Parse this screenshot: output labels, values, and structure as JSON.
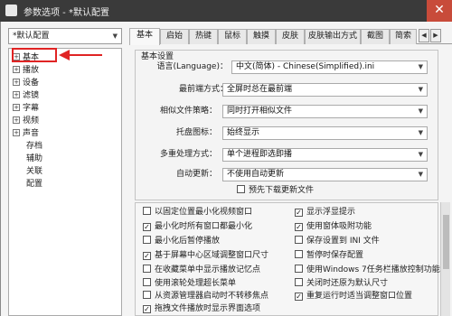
{
  "window": {
    "title": "参数选项 - *默认配置",
    "close_label": "✕"
  },
  "preset": {
    "value": "*默认配置"
  },
  "tree": {
    "items": [
      {
        "label": "基本",
        "expandable": true
      },
      {
        "label": "播放",
        "expandable": true
      },
      {
        "label": "设备",
        "expandable": true
      },
      {
        "label": "滤镜",
        "expandable": true
      },
      {
        "label": "字幕",
        "expandable": true
      },
      {
        "label": "视频",
        "expandable": true
      },
      {
        "label": "声音",
        "expandable": true
      },
      {
        "label": "存档",
        "expandable": false
      },
      {
        "label": "辅助",
        "expandable": false
      },
      {
        "label": "关联",
        "expandable": false
      },
      {
        "label": "配置",
        "expandable": false
      }
    ],
    "highlight_color": "#e02424"
  },
  "tabs": [
    {
      "label": "基本",
      "active": true
    },
    {
      "label": "启始",
      "active": false
    },
    {
      "label": "热键",
      "active": false
    },
    {
      "label": "鼠标",
      "active": false
    },
    {
      "label": "触摸",
      "active": false
    },
    {
      "label": "皮肤",
      "active": false
    },
    {
      "label": "皮肤输出方式",
      "active": false
    },
    {
      "label": "截图",
      "active": false
    },
    {
      "label": "简索",
      "active": false
    }
  ],
  "tab_scroll": {
    "left": "◀",
    "right": "▶"
  },
  "basic": {
    "group_title": "基本设置",
    "rows": [
      {
        "label": "语言(Language)：",
        "value": "中文(简体) - Chinese(Simplified).ini"
      },
      {
        "label": "最前端方式：",
        "value": "全屏时总在最前端"
      },
      {
        "label": "相似文件策略：",
        "value": "同时打开相似文件"
      },
      {
        "label": "托盘图标：",
        "value": "始终显示"
      },
      {
        "label": "多重处理方式：",
        "value": "单个进程即选即播"
      },
      {
        "label": "自动更新：",
        "value": "不使用自动更新"
      }
    ],
    "predownload": {
      "label": "预先下载更新文件",
      "checked": false
    }
  },
  "options": {
    "left": [
      {
        "label": "以固定位置最小化视频窗口",
        "checked": false
      },
      {
        "label": "最小化时所有窗口都最小化",
        "checked": true
      },
      {
        "label": "最小化后暂停播放",
        "checked": false
      },
      {
        "label": "基于屏幕中心区域调整窗口尺寸",
        "checked": true
      },
      {
        "label": "在收藏菜单中显示播放记忆点",
        "checked": false
      },
      {
        "label": "使用滚轮处理超长菜单",
        "checked": false
      },
      {
        "label": "从资源管理器启动时不转移焦点",
        "checked": false
      },
      {
        "label": "拖拽文件播放时显示界面选项",
        "checked": true
      }
    ],
    "right": [
      {
        "label": "显示浮显提示",
        "checked": true
      },
      {
        "label": "使用窗体吸附功能",
        "checked": true
      },
      {
        "label": "保存设置到 INI 文件",
        "checked": false
      },
      {
        "label": "暂停时保存配置",
        "checked": false
      },
      {
        "label": "使用Windows 7任务栏播放控制功能",
        "checked": false
      },
      {
        "label": "关闭时还原为默认尺寸",
        "checked": false
      },
      {
        "label": "重复运行时适当调整窗口位置",
        "checked": true
      }
    ]
  }
}
